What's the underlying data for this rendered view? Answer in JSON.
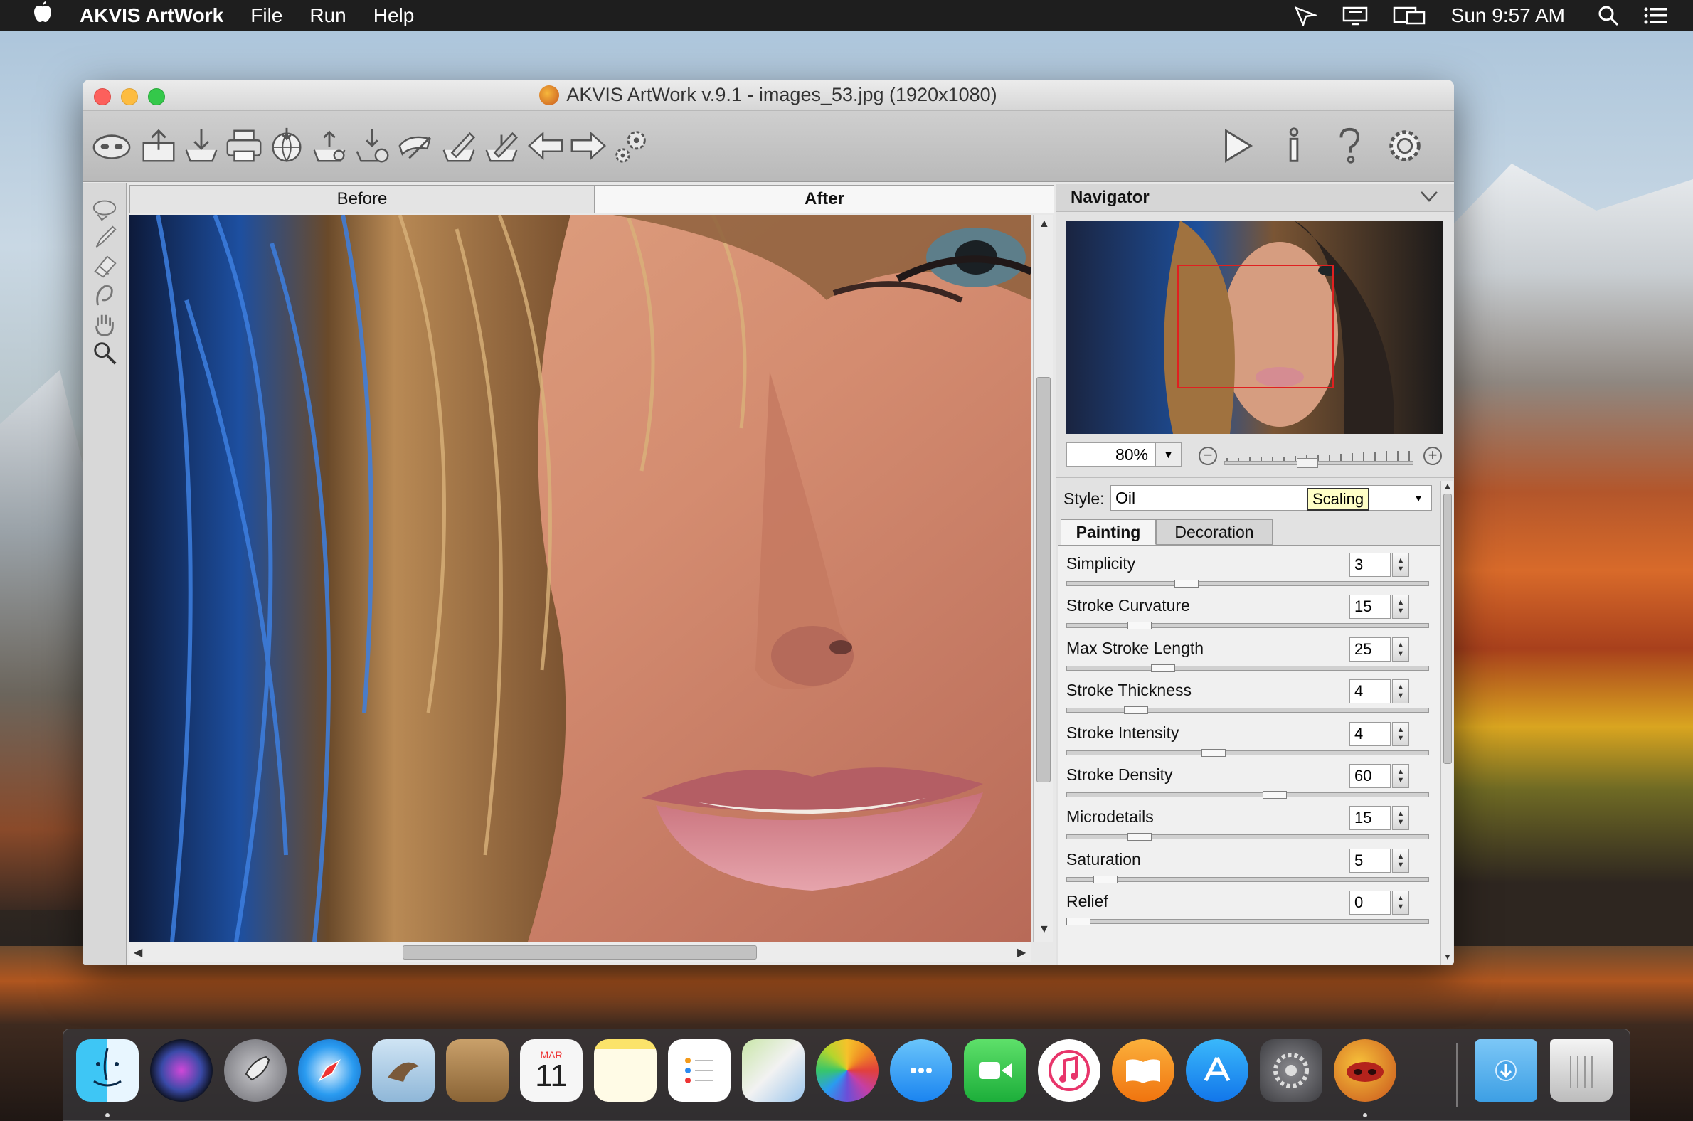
{
  "menubar": {
    "app_name": "AKVIS ArtWork",
    "menus": [
      "File",
      "Run",
      "Help"
    ],
    "clock": "Sun 9:57 AM"
  },
  "window": {
    "title": "AKVIS ArtWork v.9.1 - images_53.jpg (1920x1080)"
  },
  "view_tabs": {
    "before": "Before",
    "after": "After",
    "active": "After"
  },
  "navigator": {
    "title": "Navigator",
    "zoom": "80%"
  },
  "settings": {
    "style_label": "Style:",
    "style_value": "Oil",
    "tooltip": "Scaling",
    "tabs": [
      "Painting",
      "Decoration"
    ],
    "active_tab": "Painting",
    "params": [
      {
        "label": "Simplicity",
        "value": "3",
        "fraction": 0.32
      },
      {
        "label": "Stroke Curvature",
        "value": "15",
        "fraction": 0.18
      },
      {
        "label": "Max Stroke Length",
        "value": "25",
        "fraction": 0.25
      },
      {
        "label": "Stroke Thickness",
        "value": "4",
        "fraction": 0.17
      },
      {
        "label": "Stroke Intensity",
        "value": "4",
        "fraction": 0.4
      },
      {
        "label": "Stroke Density",
        "value": "60",
        "fraction": 0.58
      },
      {
        "label": "Microdetails",
        "value": "15",
        "fraction": 0.18
      },
      {
        "label": "Saturation",
        "value": "5",
        "fraction": 0.08
      },
      {
        "label": "Relief",
        "value": "0",
        "fraction": 0.0
      }
    ]
  },
  "dock": {
    "calendar_month": "MAR",
    "calendar_day": "11"
  },
  "colors": {
    "menubar_bg": "#1e1e1e",
    "window_bg": "#e8e8e8",
    "nav_rect": "#e02020",
    "tooltip_bg": "#ffffc6"
  }
}
